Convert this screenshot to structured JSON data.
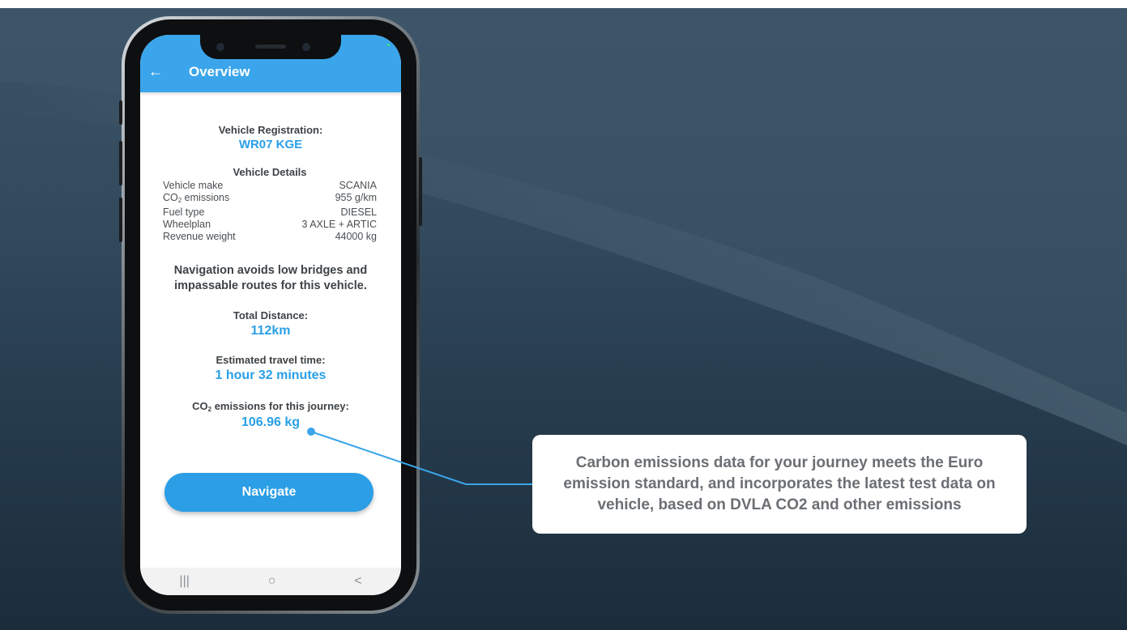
{
  "appbar": {
    "title": "Overview",
    "back_icon": "←"
  },
  "registration": {
    "label": "Vehicle Registration:",
    "value": "WR07 KGE"
  },
  "details": {
    "heading": "Vehicle Details",
    "rows": [
      {
        "label": "Vehicle make",
        "value": "SCANIA"
      },
      {
        "label_pre": "CO",
        "label_sub": "2",
        "label_post": " emissions",
        "value": "955 g/km"
      },
      {
        "label": "Fuel type",
        "value": "DIESEL"
      },
      {
        "label": "Wheelplan",
        "value": "3 AXLE + ARTIC"
      },
      {
        "label": "Revenue weight",
        "value": "44000 kg"
      }
    ]
  },
  "notice": "Navigation avoids low bridges and impassable routes for this vehicle.",
  "distance": {
    "label": "Total Distance:",
    "value": "112km"
  },
  "travel_time": {
    "label": "Estimated travel time:",
    "value": "1 hour 32 minutes"
  },
  "journey_emissions": {
    "label_pre": "CO",
    "label_sub": "2",
    "label_post": " emissions for this journey:",
    "value": "106.96 kg"
  },
  "navigate_button": "Navigate",
  "system_nav": {
    "recents": "|||",
    "home": "○",
    "back": "<"
  },
  "callout": "Carbon emissions data for your journey meets the Euro emission standard, and incorporates the latest test data on vehicle, based on DVLA CO2 and other emissions",
  "colors": {
    "accent": "#2a9fe6",
    "appbar": "#3aa5ea",
    "background": "#2b4254"
  }
}
